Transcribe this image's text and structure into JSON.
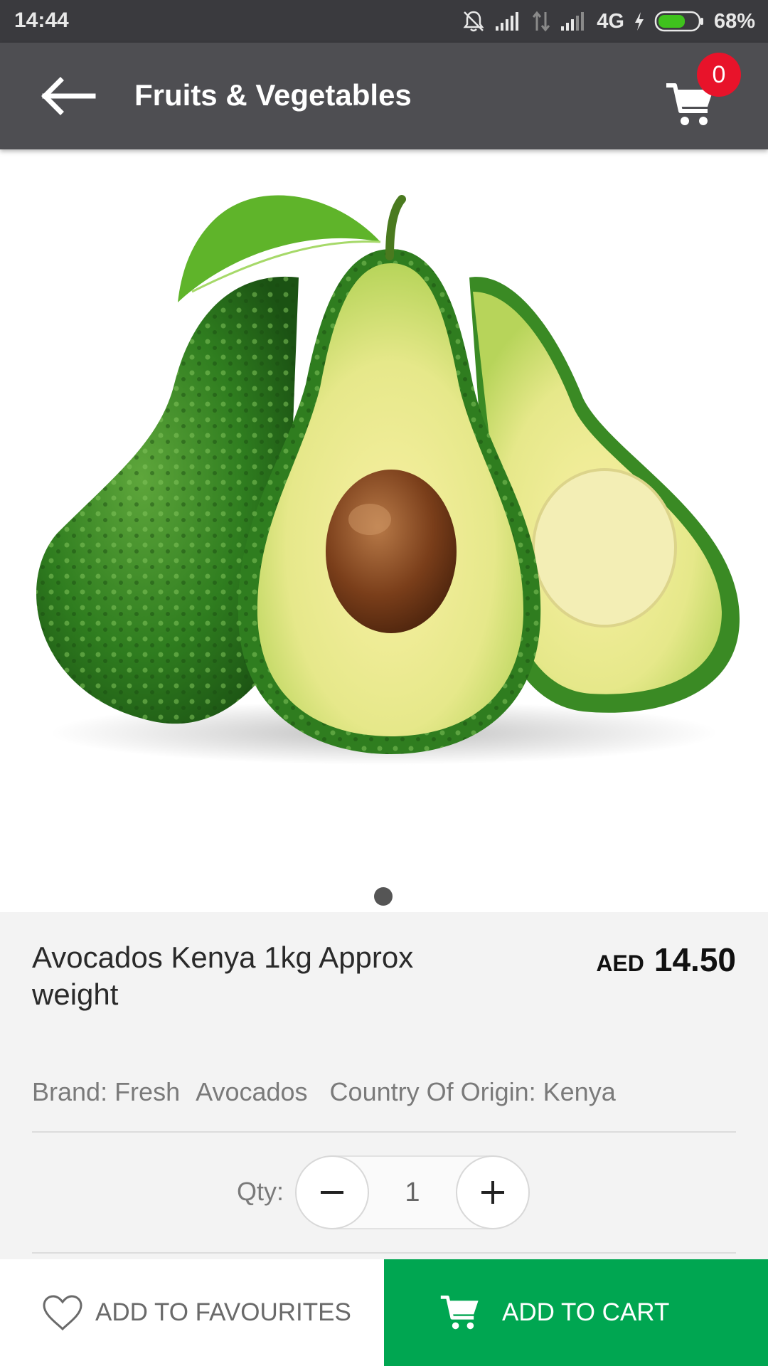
{
  "status_bar": {
    "time": "14:44",
    "network": "4G",
    "battery": "68%",
    "battery_level": 0.68
  },
  "header": {
    "title": "Fruits & Vegetables",
    "cart_count": "0",
    "back_icon": "arrow-left-icon",
    "cart_icon": "cart-icon"
  },
  "gallery": {
    "image_count": 1,
    "active_index": 0
  },
  "product": {
    "name": "Avocados Kenya 1kg Approx weight",
    "currency": "AED",
    "price": "14.50",
    "brand": "Brand: Fresh",
    "subtitle": "Avocados",
    "origin": "Country Of Origin: Kenya"
  },
  "quantity": {
    "label": "Qty:",
    "value": "1"
  },
  "actions": {
    "favourite_label": "ADD TO FAVOURITES",
    "add_to_cart_label": "ADD TO CART"
  },
  "colors": {
    "accent_green": "#00a651",
    "badge_red": "#e8132a",
    "app_bar": "#4e4e52",
    "status_bar": "#3a3a3e"
  }
}
